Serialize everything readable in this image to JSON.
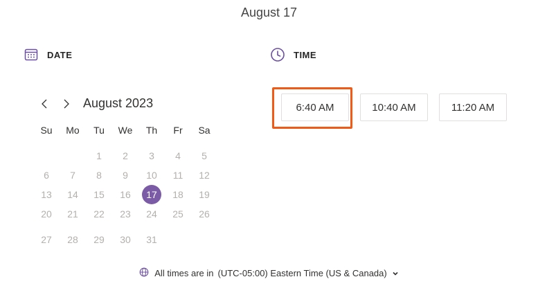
{
  "header": {
    "title": "August 17"
  },
  "date_section": {
    "label": "DATE",
    "icon": "calendar-icon"
  },
  "time_section": {
    "label": "TIME",
    "icon": "clock-icon"
  },
  "calendar": {
    "month_label": "August 2023",
    "weekdays": [
      "Su",
      "Mo",
      "Tu",
      "We",
      "Th",
      "Fr",
      "Sa"
    ],
    "weeks": [
      [
        "",
        "",
        "1",
        "2",
        "3",
        "4",
        "5"
      ],
      [
        "6",
        "7",
        "8",
        "9",
        "10",
        "11",
        "12"
      ],
      [
        "13",
        "14",
        "15",
        "16",
        "17",
        "18",
        "19"
      ],
      [
        "20",
        "21",
        "22",
        "23",
        "24",
        "25",
        "26"
      ],
      [
        "27",
        "28",
        "29",
        "30",
        "31",
        "",
        ""
      ]
    ],
    "selected_day": "17",
    "accent_color": "#7b5ba6"
  },
  "time_slots": [
    "6:40 AM",
    "10:40 AM",
    "11:20 AM"
  ],
  "annotation": {
    "highlighted_slot": "6:40 AM",
    "color": "#f05a14"
  },
  "timezone": {
    "prefix": "All times are in",
    "value": "(UTC-05:00) Eastern Time (US & Canada)"
  }
}
